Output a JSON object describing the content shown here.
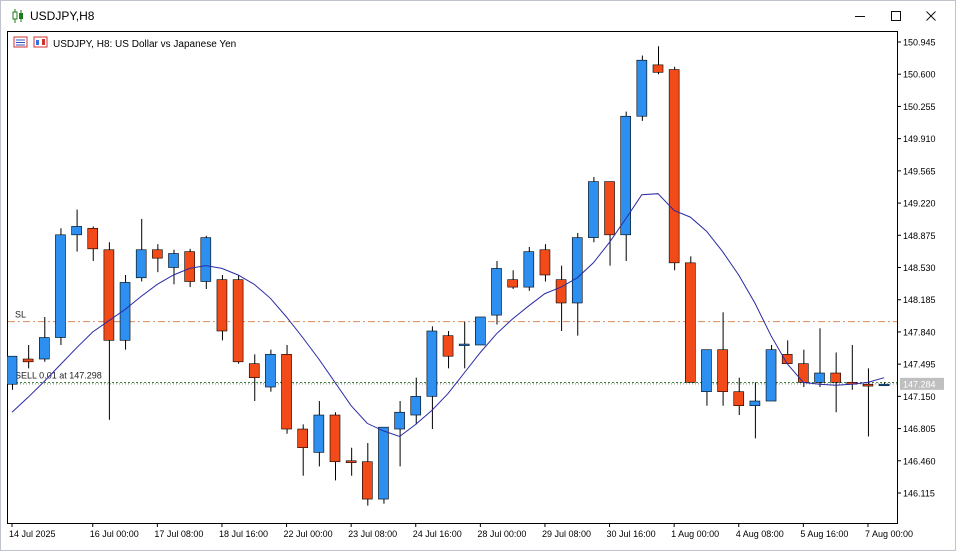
{
  "window": {
    "title": "USDJPY,H8",
    "controls": [
      "minimize",
      "maximize",
      "close"
    ]
  },
  "chart_header": {
    "symbol_desc": "USDJPY, H8:  US Dollar vs Japanese Yen"
  },
  "chart_data": {
    "type": "candlestick",
    "symbol": "USDJPY",
    "timeframe": "H8",
    "ylim": [
      145.85,
      151.1
    ],
    "y_ticks": [
      "150.945",
      "150.600",
      "150.255",
      "149.910",
      "149.565",
      "149.220",
      "148.875",
      "148.530",
      "148.185",
      "147.840",
      "147.495",
      "147.150",
      "146.805",
      "146.460",
      "146.115"
    ],
    "x_ticks": [
      {
        "label": "14 Jul 2025",
        "index": 0
      },
      {
        "label": "16 Jul 00:00",
        "index": 5
      },
      {
        "label": "17 Jul 08:00",
        "index": 9
      },
      {
        "label": "18 Jul 16:00",
        "index": 13
      },
      {
        "label": "22 Jul 00:00",
        "index": 17
      },
      {
        "label": "23 Jul 08:00",
        "index": 21
      },
      {
        "label": "24 Jul 16:00",
        "index": 25
      },
      {
        "label": "28 Jul 00:00",
        "index": 29
      },
      {
        "label": "29 Jul 08:00",
        "index": 33
      },
      {
        "label": "30 Jul 16:00",
        "index": 37
      },
      {
        "label": "1 Aug 00:00",
        "index": 41
      },
      {
        "label": "4 Aug 08:00",
        "index": 45
      },
      {
        "label": "5 Aug 16:00",
        "index": 49
      },
      {
        "label": "7 Aug 00:00",
        "index": 53
      }
    ],
    "candles": [
      {
        "o": 147.28,
        "h": 147.58,
        "l": 147.22,
        "c": 147.58
      },
      {
        "o": 147.55,
        "h": 147.7,
        "l": 147.45,
        "c": 147.52
      },
      {
        "o": 147.55,
        "h": 148.0,
        "l": 147.52,
        "c": 147.78
      },
      {
        "o": 147.78,
        "h": 148.95,
        "l": 147.7,
        "c": 148.88
      },
      {
        "o": 148.88,
        "h": 149.15,
        "l": 148.7,
        "c": 148.97
      },
      {
        "o": 148.95,
        "h": 148.97,
        "l": 148.6,
        "c": 148.73
      },
      {
        "o": 148.72,
        "h": 148.8,
        "l": 146.9,
        "c": 147.75
      },
      {
        "o": 147.75,
        "h": 148.45,
        "l": 147.65,
        "c": 148.37
      },
      {
        "o": 148.42,
        "h": 149.05,
        "l": 148.38,
        "c": 148.72
      },
      {
        "o": 148.72,
        "h": 148.78,
        "l": 148.48,
        "c": 148.63
      },
      {
        "o": 148.53,
        "h": 148.72,
        "l": 148.35,
        "c": 148.68
      },
      {
        "o": 148.7,
        "h": 148.73,
        "l": 148.32,
        "c": 148.38
      },
      {
        "o": 148.38,
        "h": 148.87,
        "l": 148.3,
        "c": 148.85
      },
      {
        "o": 148.4,
        "h": 148.45,
        "l": 147.75,
        "c": 147.85
      },
      {
        "o": 148.4,
        "h": 148.45,
        "l": 147.5,
        "c": 147.52
      },
      {
        "o": 147.5,
        "h": 147.6,
        "l": 147.1,
        "c": 147.35
      },
      {
        "o": 147.25,
        "h": 147.65,
        "l": 147.2,
        "c": 147.6
      },
      {
        "o": 147.6,
        "h": 147.7,
        "l": 146.75,
        "c": 146.8
      },
      {
        "o": 146.8,
        "h": 146.85,
        "l": 146.3,
        "c": 146.6
      },
      {
        "o": 146.55,
        "h": 147.1,
        "l": 146.4,
        "c": 146.95
      },
      {
        "o": 146.95,
        "h": 146.98,
        "l": 146.25,
        "c": 146.45
      },
      {
        "o": 146.46,
        "h": 146.6,
        "l": 146.3,
        "c": 146.44
      },
      {
        "o": 146.45,
        "h": 146.65,
        "l": 145.98,
        "c": 146.05
      },
      {
        "o": 146.05,
        "h": 146.82,
        "l": 146.0,
        "c": 146.82
      },
      {
        "o": 146.8,
        "h": 147.1,
        "l": 146.4,
        "c": 146.98
      },
      {
        "o": 146.95,
        "h": 147.35,
        "l": 146.85,
        "c": 147.15
      },
      {
        "o": 147.15,
        "h": 147.9,
        "l": 146.8,
        "c": 147.85
      },
      {
        "o": 147.8,
        "h": 147.85,
        "l": 147.45,
        "c": 147.58
      },
      {
        "o": 147.7,
        "h": 147.95,
        "l": 147.45,
        "c": 147.71
      },
      {
        "o": 147.7,
        "h": 148.0,
        "l": 147.7,
        "c": 148.0
      },
      {
        "o": 148.02,
        "h": 148.6,
        "l": 147.92,
        "c": 148.52
      },
      {
        "o": 148.4,
        "h": 148.5,
        "l": 148.3,
        "c": 148.32
      },
      {
        "o": 148.32,
        "h": 148.75,
        "l": 148.28,
        "c": 148.7
      },
      {
        "o": 148.72,
        "h": 148.78,
        "l": 148.38,
        "c": 148.45
      },
      {
        "o": 148.4,
        "h": 148.55,
        "l": 147.85,
        "c": 148.15
      },
      {
        "o": 148.15,
        "h": 148.9,
        "l": 147.8,
        "c": 148.85
      },
      {
        "o": 148.85,
        "h": 149.5,
        "l": 148.8,
        "c": 149.45
      },
      {
        "o": 149.45,
        "h": 149.45,
        "l": 148.55,
        "c": 148.88
      },
      {
        "o": 148.88,
        "h": 150.2,
        "l": 148.6,
        "c": 150.15
      },
      {
        "o": 150.15,
        "h": 150.8,
        "l": 150.1,
        "c": 150.75
      },
      {
        "o": 150.7,
        "h": 150.9,
        "l": 150.6,
        "c": 150.62
      },
      {
        "o": 150.65,
        "h": 150.68,
        "l": 148.5,
        "c": 148.58
      },
      {
        "o": 148.58,
        "h": 148.65,
        "l": 147.3,
        "c": 147.3
      },
      {
        "o": 147.2,
        "h": 147.65,
        "l": 147.05,
        "c": 147.65
      },
      {
        "o": 147.65,
        "h": 148.05,
        "l": 147.05,
        "c": 147.2
      },
      {
        "o": 147.2,
        "h": 147.35,
        "l": 146.95,
        "c": 147.05
      },
      {
        "o": 147.05,
        "h": 147.3,
        "l": 146.7,
        "c": 147.1
      },
      {
        "o": 147.1,
        "h": 147.7,
        "l": 147.1,
        "c": 147.65
      },
      {
        "o": 147.6,
        "h": 147.75,
        "l": 147.5,
        "c": 147.5
      },
      {
        "o": 147.5,
        "h": 147.65,
        "l": 147.25,
        "c": 147.3
      },
      {
        "o": 147.3,
        "h": 147.88,
        "l": 147.25,
        "c": 147.4
      },
      {
        "o": 147.4,
        "h": 147.62,
        "l": 146.98,
        "c": 147.3
      },
      {
        "o": 147.3,
        "h": 147.7,
        "l": 147.22,
        "c": 147.28
      },
      {
        "o": 147.28,
        "h": 147.45,
        "l": 146.72,
        "c": 147.26
      },
      {
        "o": 147.28,
        "h": 147.3,
        "l": 147.26,
        "c": 147.28
      }
    ],
    "moving_average": [
      146.98,
      147.14,
      147.31,
      147.49,
      147.67,
      147.84,
      147.96,
      148.08,
      148.22,
      148.35,
      148.45,
      148.52,
      148.55,
      148.52,
      148.45,
      148.35,
      148.2,
      148.0,
      147.78,
      147.55,
      147.3,
      147.05,
      146.86,
      146.78,
      146.72,
      146.85,
      147.0,
      147.18,
      147.4,
      147.62,
      147.82,
      147.98,
      148.12,
      148.25,
      148.32,
      148.42,
      148.58,
      148.8,
      149.05,
      149.31,
      149.32,
      149.14,
      149.07,
      148.92,
      148.7,
      148.45,
      148.15,
      147.8,
      147.5,
      147.3,
      147.28,
      147.27,
      147.28,
      147.3,
      147.35
    ],
    "horizontal_lines": {
      "stop_loss": {
        "label": "SL",
        "value": 147.95
      },
      "order": {
        "label": "SELL 0.01 at 147.298",
        "value": 147.298
      }
    },
    "bid_tag": "147.284",
    "grid": false
  },
  "colors": {
    "bull": "#2d8ff0",
    "bear": "#f24a18",
    "wick": "#000000",
    "ma_line": "#2a2aa6",
    "sl_line": "#d98a5a",
    "order_line": "#3a8a3a",
    "bid_tag_bg": "#bfbfbf",
    "bid_line": "#7f7f7f",
    "background": "#ffffff"
  }
}
